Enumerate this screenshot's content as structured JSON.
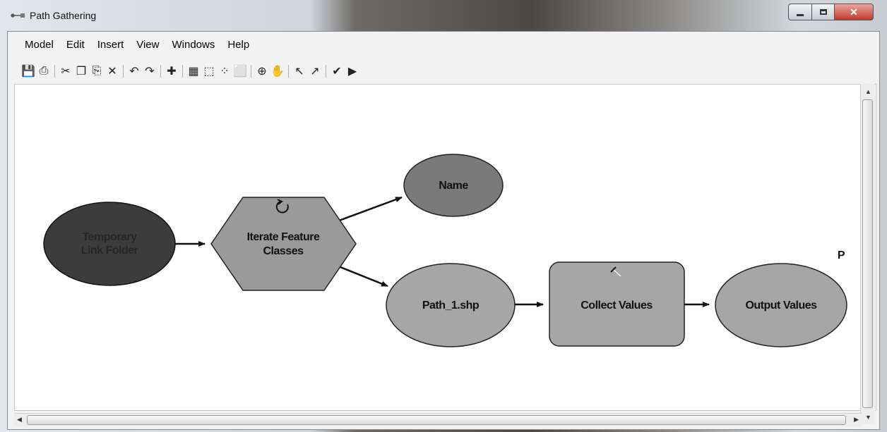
{
  "window": {
    "title": "Path Gathering"
  },
  "menu": [
    "Model",
    "Edit",
    "Insert",
    "View",
    "Windows",
    "Help"
  ],
  "toolbar": [
    {
      "icon": "save-icon",
      "glyph": "💾"
    },
    {
      "icon": "print-icon",
      "glyph": "⎙"
    },
    {
      "sep": true
    },
    {
      "icon": "cut-icon",
      "glyph": "✂"
    },
    {
      "icon": "copy-icon",
      "glyph": "❐"
    },
    {
      "icon": "paste-icon",
      "glyph": "⎘"
    },
    {
      "icon": "delete-icon",
      "glyph": "✕"
    },
    {
      "sep": true
    },
    {
      "icon": "undo-icon",
      "glyph": "↶"
    },
    {
      "icon": "redo-icon",
      "glyph": "↷"
    },
    {
      "sep": true
    },
    {
      "icon": "add-data-icon",
      "glyph": "✚"
    },
    {
      "sep": true
    },
    {
      "icon": "auto-layout-icon",
      "glyph": "▦"
    },
    {
      "icon": "full-extent-icon",
      "glyph": "⬚"
    },
    {
      "icon": "fixed-zoom-in-icon",
      "glyph": "⁘"
    },
    {
      "icon": "fixed-zoom-out-icon",
      "glyph": "⬜"
    },
    {
      "sep": true
    },
    {
      "icon": "zoom-in-icon",
      "glyph": "⊕"
    },
    {
      "icon": "pan-icon",
      "glyph": "✋"
    },
    {
      "sep": true
    },
    {
      "icon": "select-icon",
      "glyph": "↖"
    },
    {
      "icon": "connect-icon",
      "glyph": "↗"
    },
    {
      "sep": true
    },
    {
      "icon": "validate-icon",
      "glyph": "✔"
    },
    {
      "icon": "run-icon",
      "glyph": "▶"
    }
  ],
  "diagram": {
    "nodes": {
      "temp_folder": {
        "lines": [
          "Temporary",
          "Link Folder"
        ],
        "color": "#3c3c3c"
      },
      "iterate": {
        "lines": [
          "Iterate Feature",
          "Classes"
        ],
        "color": "#9a9a9a"
      },
      "name": {
        "lines": [
          "Name"
        ],
        "color": "#7a7a7a"
      },
      "path_shp": {
        "lines": [
          "Path_1.shp"
        ],
        "color": "#a6a6a6"
      },
      "collect": {
        "lines": [
          "Collect Values"
        ],
        "color": "#a6a6a6"
      },
      "output": {
        "lines": [
          "Output Values"
        ],
        "color": "#a6a6a6"
      }
    },
    "stray_label": "P"
  }
}
